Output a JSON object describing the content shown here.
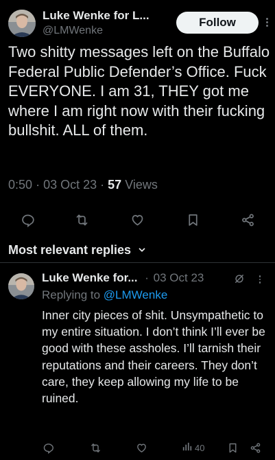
{
  "tweet": {
    "author_name": "Luke Wenke for L...",
    "author_handle": "@LMWenke",
    "follow_label": "Follow",
    "text": "Two shitty messages left on the Buffalo Federal Public Defender’s Office.  Fuck EVERYONE.  I am 31, THEY got me where I am right now with their fucking bullshit.  ALL of them.",
    "time": "0:50",
    "date": "03 Oct 23",
    "views_count": "57",
    "views_label": "Views",
    "separator": "·"
  },
  "replies_header": "Most relevant replies",
  "reply": {
    "author_name": "Luke Wenke for...",
    "separator": "·",
    "date": "03 Oct 23",
    "replying_to_label": "Replying to",
    "replying_to_handle": "@LMWenke",
    "text": "Inner city pieces of shit.  Unsympathetic to my entire situation.  I don’t think I’ll ever be good with these assholes.  I’ll tarnish their reputations and their careers.  They don’t care, they keep allowing my life to be ruined.",
    "views": "40"
  },
  "colors": {
    "background": "#000000",
    "text": "#e7e9ea",
    "muted": "#71767b",
    "link": "#1d9bf0",
    "divider": "#2f3336"
  },
  "icons": [
    "avatar",
    "more-icon",
    "reply-icon",
    "retweet-icon",
    "like-icon",
    "bookmark-icon",
    "share-icon",
    "chevron-down-icon",
    "grok-icon",
    "views-icon"
  ]
}
